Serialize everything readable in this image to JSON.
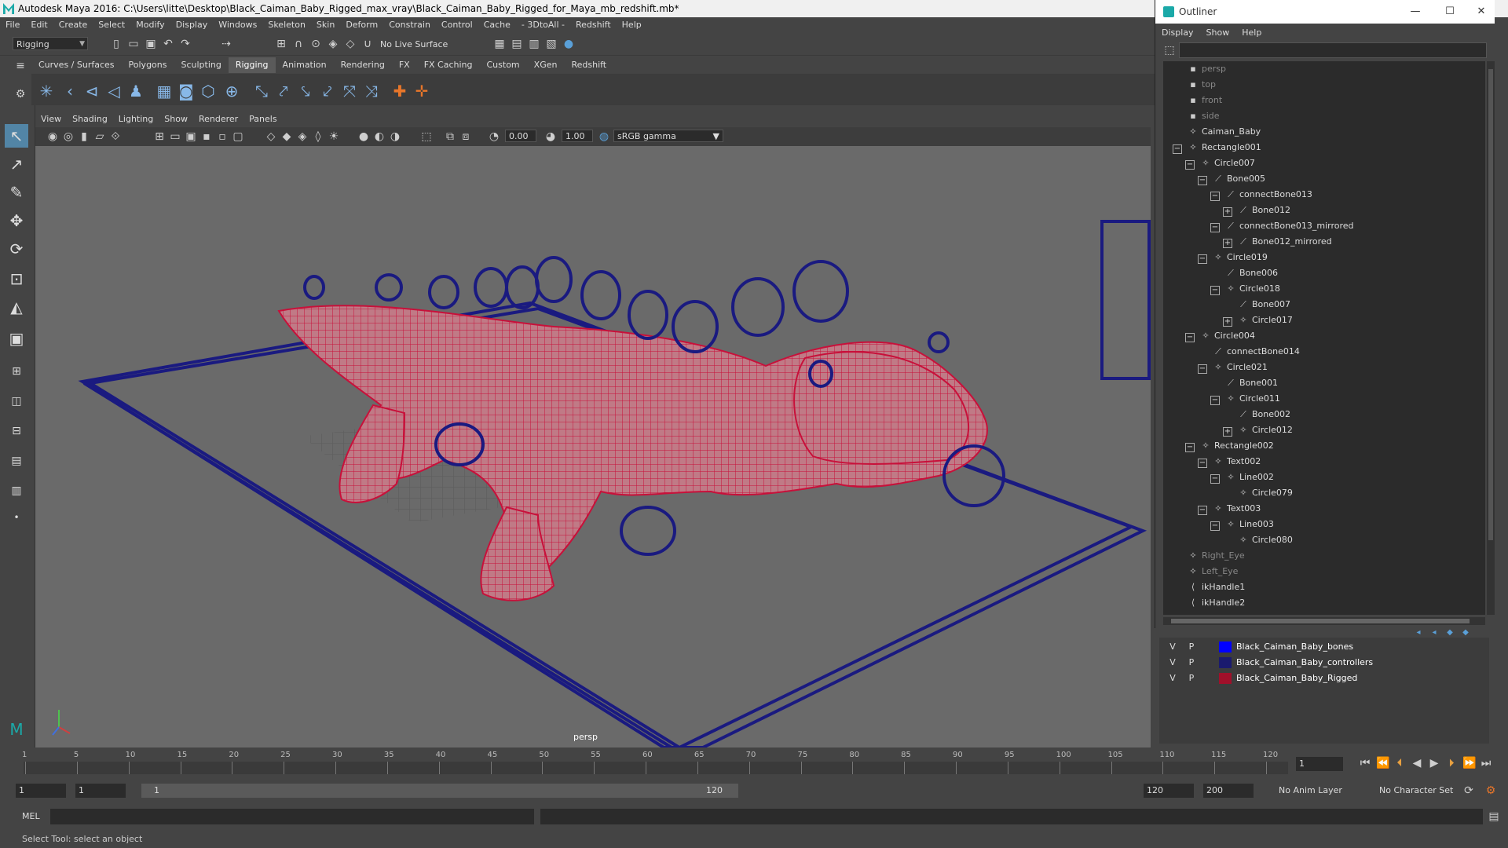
{
  "window": {
    "title": "Autodesk Maya 2016: C:\\Users\\litte\\Desktop\\Black_Caiman_Baby_Rigged_max_vray\\Black_Caiman_Baby_Rigged_for_Maya_mb_redshift.mb*"
  },
  "menubar": [
    "File",
    "Edit",
    "Create",
    "Select",
    "Modify",
    "Display",
    "Windows",
    "Skeleton",
    "Skin",
    "Deform",
    "Constrain",
    "Control",
    "Cache",
    "- 3DtoAll -",
    "Redshift",
    "Help"
  ],
  "status": {
    "mode": "Rigging",
    "live_surface": "No Live Surface"
  },
  "shelf_tabs": [
    {
      "label": "Curves / Surfaces",
      "active": false
    },
    {
      "label": "Polygons",
      "active": false
    },
    {
      "label": "Sculpting",
      "active": false
    },
    {
      "label": "Rigging",
      "active": true
    },
    {
      "label": "Animation",
      "active": false
    },
    {
      "label": "Rendering",
      "active": false
    },
    {
      "label": "FX",
      "active": false
    },
    {
      "label": "FX Caching",
      "active": false
    },
    {
      "label": "Custom",
      "active": false
    },
    {
      "label": "XGen",
      "active": false
    },
    {
      "label": "Redshift",
      "active": false
    }
  ],
  "viewport": {
    "menu": [
      "View",
      "Shading",
      "Lighting",
      "Show",
      "Renderer",
      "Panels"
    ],
    "exposure": "0.00",
    "gamma": "1.00",
    "color_space": "sRGB gamma",
    "camera_label": "persp"
  },
  "outliner": {
    "title": "Outliner",
    "menu": [
      "Display",
      "Show",
      "Help"
    ],
    "items": [
      {
        "label": "persp",
        "depth": 0,
        "toggle": "",
        "icon": "camera-icon",
        "dim": true
      },
      {
        "label": "top",
        "depth": 0,
        "toggle": "",
        "icon": "camera-icon",
        "dim": true
      },
      {
        "label": "front",
        "depth": 0,
        "toggle": "",
        "icon": "camera-icon",
        "dim": true
      },
      {
        "label": "side",
        "depth": 0,
        "toggle": "",
        "icon": "camera-icon",
        "dim": true
      },
      {
        "label": "Caiman_Baby",
        "depth": 0,
        "toggle": "",
        "icon": "transform-icon",
        "dim": false
      },
      {
        "label": "Rectangle001",
        "depth": 0,
        "toggle": "−",
        "icon": "transform-icon",
        "dim": false
      },
      {
        "label": "Circle007",
        "depth": 1,
        "toggle": "−",
        "icon": "transform-icon",
        "dim": false
      },
      {
        "label": "Bone005",
        "depth": 2,
        "toggle": "−",
        "icon": "joint-icon",
        "dim": false
      },
      {
        "label": "connectBone013",
        "depth": 3,
        "toggle": "−",
        "icon": "joint-icon",
        "dim": false
      },
      {
        "label": "Bone012",
        "depth": 4,
        "toggle": "+",
        "icon": "joint-icon",
        "dim": false
      },
      {
        "label": "connectBone013_mirrored",
        "depth": 3,
        "toggle": "−",
        "icon": "joint-icon",
        "dim": false
      },
      {
        "label": "Bone012_mirrored",
        "depth": 4,
        "toggle": "+",
        "icon": "joint-icon",
        "dim": false
      },
      {
        "label": "Circle019",
        "depth": 2,
        "toggle": "−",
        "icon": "transform-icon",
        "dim": false
      },
      {
        "label": "Bone006",
        "depth": 3,
        "toggle": "",
        "icon": "joint-icon",
        "dim": false
      },
      {
        "label": "Circle018",
        "depth": 3,
        "toggle": "−",
        "icon": "transform-icon",
        "dim": false
      },
      {
        "label": "Bone007",
        "depth": 4,
        "toggle": "",
        "icon": "joint-icon",
        "dim": false
      },
      {
        "label": "Circle017",
        "depth": 4,
        "toggle": "+",
        "icon": "transform-icon",
        "dim": false
      },
      {
        "label": "Circle004",
        "depth": 1,
        "toggle": "−",
        "icon": "transform-icon",
        "dim": false
      },
      {
        "label": "connectBone014",
        "depth": 2,
        "toggle": "",
        "icon": "joint-icon",
        "dim": false
      },
      {
        "label": "Circle021",
        "depth": 2,
        "toggle": "−",
        "icon": "transform-icon",
        "dim": false
      },
      {
        "label": "Bone001",
        "depth": 3,
        "toggle": "",
        "icon": "joint-icon",
        "dim": false
      },
      {
        "label": "Circle011",
        "depth": 3,
        "toggle": "−",
        "icon": "transform-icon",
        "dim": false
      },
      {
        "label": "Bone002",
        "depth": 4,
        "toggle": "",
        "icon": "joint-icon",
        "dim": false
      },
      {
        "label": "Circle012",
        "depth": 4,
        "toggle": "+",
        "icon": "transform-icon",
        "dim": false
      },
      {
        "label": "Rectangle002",
        "depth": 1,
        "toggle": "−",
        "icon": "transform-icon",
        "dim": false
      },
      {
        "label": "Text002",
        "depth": 2,
        "toggle": "−",
        "icon": "transform-icon",
        "dim": false
      },
      {
        "label": "Line002",
        "depth": 3,
        "toggle": "−",
        "icon": "transform-icon",
        "dim": false
      },
      {
        "label": "Circle079",
        "depth": 4,
        "toggle": "",
        "icon": "transform-icon",
        "dim": false
      },
      {
        "label": "Text003",
        "depth": 2,
        "toggle": "−",
        "icon": "transform-icon",
        "dim": false
      },
      {
        "label": "Line003",
        "depth": 3,
        "toggle": "−",
        "icon": "transform-icon",
        "dim": false
      },
      {
        "label": "Circle080",
        "depth": 4,
        "toggle": "",
        "icon": "transform-icon",
        "dim": false
      },
      {
        "label": "Right_Eye",
        "depth": 0,
        "toggle": "",
        "icon": "transform-icon",
        "dim": true
      },
      {
        "label": "Left_Eye",
        "depth": 0,
        "toggle": "",
        "icon": "transform-icon",
        "dim": true
      },
      {
        "label": "ikHandle1",
        "depth": 0,
        "toggle": "",
        "icon": "ikhandle-icon",
        "dim": false
      },
      {
        "label": "ikHandle2",
        "depth": 0,
        "toggle": "",
        "icon": "ikhandle-icon",
        "dim": false
      }
    ]
  },
  "layers": [
    {
      "v": "V",
      "p": "P",
      "color": "#0000ff",
      "name": "Black_Caiman_Baby_bones"
    },
    {
      "v": "V",
      "p": "P",
      "color": "#1a1a6e",
      "name": "Black_Caiman_Baby_controllers"
    },
    {
      "v": "V",
      "p": "P",
      "color": "#a0102a",
      "name": "Black_Caiman_Baby_Rigged"
    }
  ],
  "timeline": {
    "ticks": [
      "1",
      "5",
      "10",
      "15",
      "20",
      "25",
      "30",
      "35",
      "40",
      "45",
      "50",
      "55",
      "60",
      "65",
      "70",
      "75",
      "80",
      "85",
      "90",
      "95",
      "100",
      "105",
      "110",
      "115",
      "120"
    ],
    "current_frame": "1"
  },
  "range": {
    "start": "1",
    "anim_start": "1",
    "slider_start": "1",
    "slider_end": "120",
    "anim_end": "120",
    "end": "200",
    "anim_layer": "No Anim Layer",
    "char_set": "No Character Set"
  },
  "cmd": {
    "lang": "MEL"
  },
  "help": {
    "text": "Select Tool: select an object"
  },
  "colors": {
    "wire": "#c8103a",
    "controller": "#1a1a80",
    "accent": "#5285a6"
  }
}
